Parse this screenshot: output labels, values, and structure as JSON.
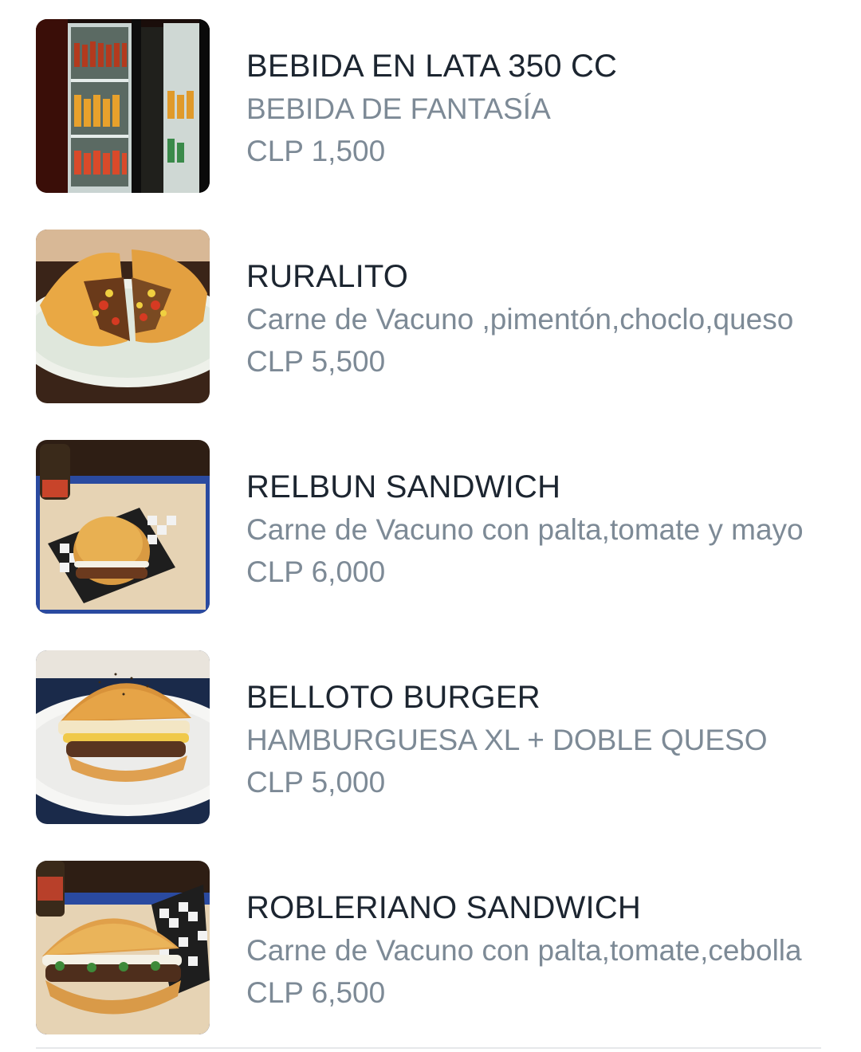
{
  "products": [
    {
      "name": "BEBIDA EN LATA 350 CC",
      "description": "BEBIDA DE FANTASÍA",
      "price": "CLP 1,500",
      "image_icon": "drinks-fridge-photo"
    },
    {
      "name": "RURALITO",
      "description": "Carne de Vacuno ,pimentón,choclo,queso",
      "price": "CLP 5,500",
      "image_icon": "sandwich-photo"
    },
    {
      "name": "RELBUN SANDWICH",
      "description": "Carne de Vacuno con palta,tomate y mayo",
      "price": "CLP 6,000",
      "image_icon": "burger-tray-photo"
    },
    {
      "name": "BELLOTO BURGER",
      "description": "HAMBURGUESA XL +  DOBLE QUESO",
      "price": "CLP 5,000",
      "image_icon": "burger-plate-photo"
    },
    {
      "name": "ROBLERIANO SANDWICH",
      "description": "Carne de Vacuno con palta,tomate,cebolla",
      "price": "CLP 6,500",
      "image_icon": "sandwich-tray-photo"
    }
  ],
  "colors": {
    "title": "#1c2530",
    "secondary": "#7d8a96",
    "divider": "#e6e8ea"
  }
}
